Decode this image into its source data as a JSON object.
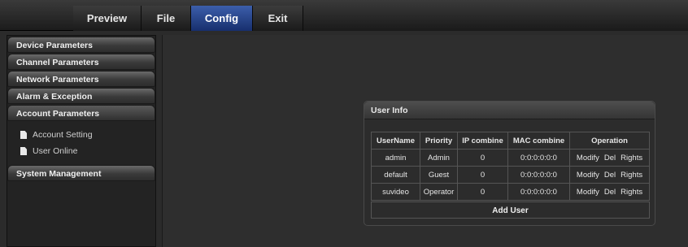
{
  "nav": {
    "tabs": [
      {
        "label": "Preview"
      },
      {
        "label": "File"
      },
      {
        "label": "Config",
        "active": true
      },
      {
        "label": "Exit"
      }
    ]
  },
  "sidebar": {
    "items": [
      {
        "label": "Device Parameters"
      },
      {
        "label": "Channel Parameters"
      },
      {
        "label": "Network Parameters"
      },
      {
        "label": "Alarm & Exception"
      },
      {
        "label": "Account Parameters",
        "expanded": true,
        "subitems": [
          {
            "label": "Account Setting",
            "icon": "document-icon"
          },
          {
            "label": "User Online",
            "icon": "document-icon"
          }
        ]
      },
      {
        "label": "System Management"
      }
    ]
  },
  "user_info": {
    "title": "User Info",
    "columns": [
      "UserName",
      "Priority",
      "IP combine",
      "MAC combine",
      "Operation"
    ],
    "rows": [
      {
        "username": "admin",
        "priority": "Admin",
        "ip": "0",
        "mac": "0:0:0:0:0:0"
      },
      {
        "username": "default",
        "priority": "Guest",
        "ip": "0",
        "mac": "0:0:0:0:0:0"
      },
      {
        "username": "suvideo",
        "priority": "Operator",
        "ip": "0",
        "mac": "0:0:0:0:0:0"
      }
    ],
    "operations": {
      "modify": "Modify",
      "del": "Del",
      "rights": "Rights"
    },
    "add_user_label": "Add User"
  },
  "colors": {
    "active_tab": "#2b4a94",
    "background": "#2b2b2b"
  }
}
